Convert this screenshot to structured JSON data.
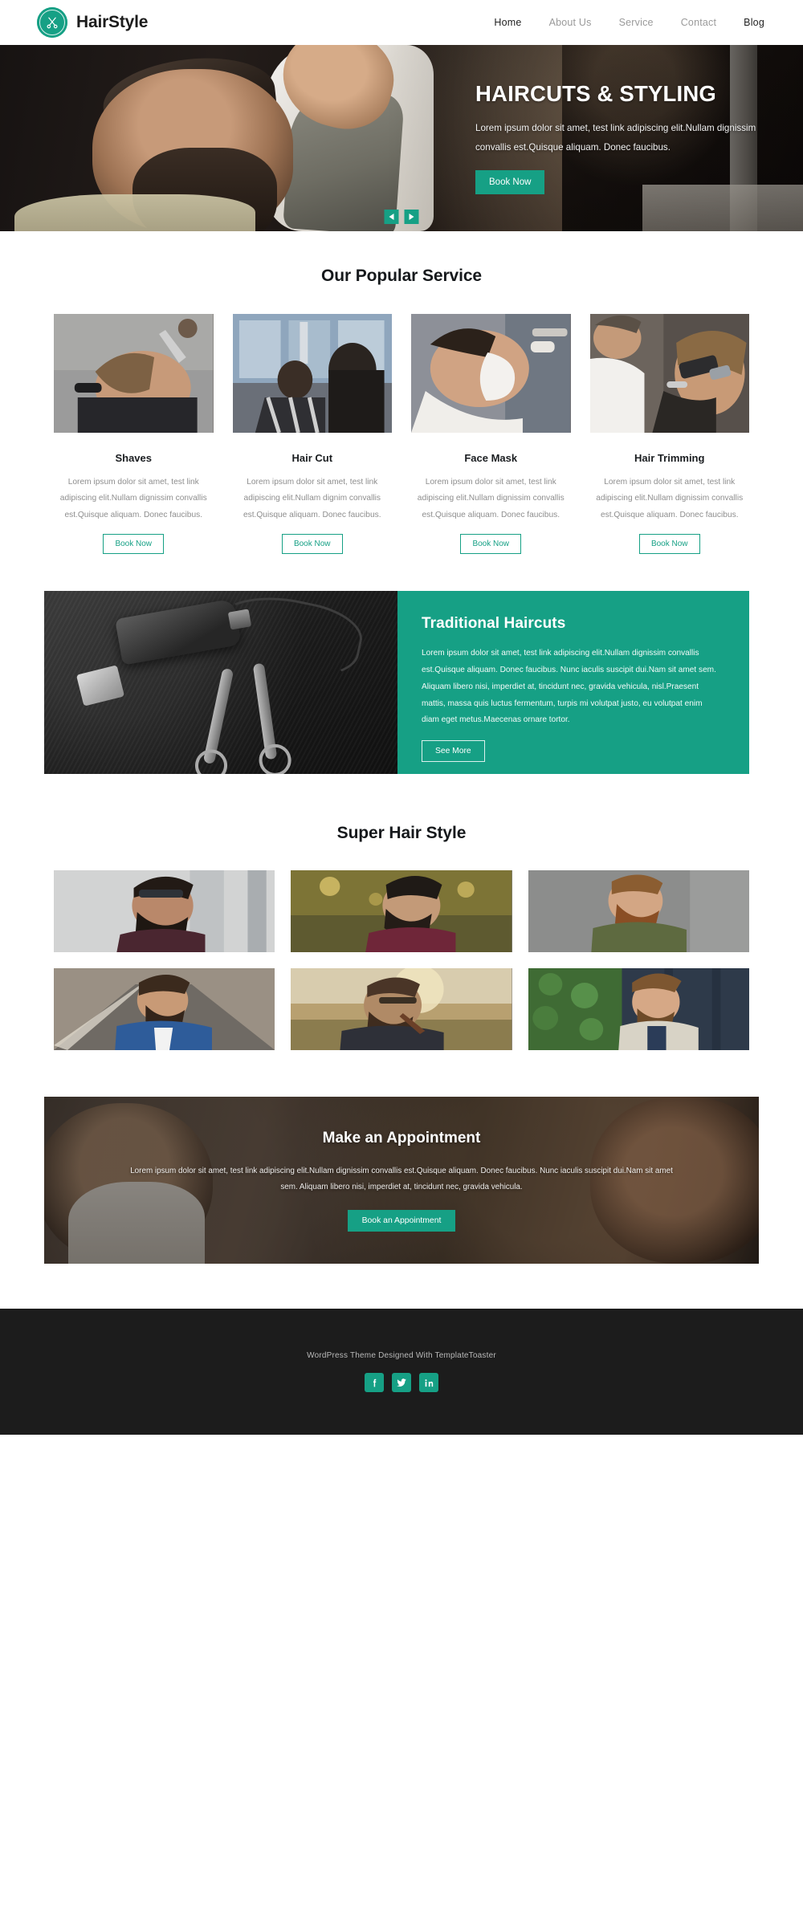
{
  "brand": {
    "name": "HairStyle",
    "logo_icon": "scissors-badge-icon"
  },
  "nav": {
    "items": [
      {
        "label": "Home",
        "active": true
      },
      {
        "label": "About Us",
        "active": false
      },
      {
        "label": "Service",
        "active": false
      },
      {
        "label": "Contact",
        "active": false
      },
      {
        "label": "Blog",
        "active": true
      }
    ]
  },
  "hero": {
    "title": "HAIRCUTS & STYLING",
    "subtitle": "Lorem ipsum dolor sit amet, test link adipiscing elit.Nullam dignissim convallis est.Quisque aliquam. Donec faucibus.",
    "cta": "Book Now",
    "prev_icon": "chevron-left-icon",
    "next_icon": "chevron-right-icon"
  },
  "services": {
    "title": "Our Popular Service",
    "cards": [
      {
        "name": "Shaves",
        "desc": "Lorem ipsum dolor sit amet, test link adipiscing elit.Nullam dignissim convallis est.Quisque aliquam. Donec faucibus.",
        "cta": "Book Now"
      },
      {
        "name": "Hair Cut",
        "desc": "Lorem ipsum dolor sit amet, test link adipiscing elit.Nullam dignim convallis est.Quisque aliquam. Donec faucibus.",
        "cta": "Book Now"
      },
      {
        "name": "Face Mask",
        "desc": "Lorem ipsum dolor sit amet, test link adipiscing elit.Nullam dignissim convallis est.Quisque aliquam. Donec faucibus.",
        "cta": "Book Now"
      },
      {
        "name": "Hair Trimming",
        "desc": "Lorem ipsum dolor sit amet, test link adipiscing elit.Nullam dignissim convallis est.Quisque aliquam. Donec faucibus.",
        "cta": "Book Now"
      }
    ]
  },
  "traditional": {
    "title": "Traditional Haircuts",
    "text": "Lorem ipsum dolor sit amet, test link adipiscing elit.Nullam dignissim convallis est.Quisque aliquam. Donec faucibus. Nunc iaculis suscipit dui.Nam sit amet sem. Aliquam libero nisi, imperdiet at, tincidunt nec, gravida vehicula, nisl.Praesent mattis, massa quis luctus fermentum, turpis mi volutpat justo, eu volutpat enim diam eget metus.Maecenas ornare tortor.",
    "cta": "See More"
  },
  "gallery": {
    "title": "Super Hair Style",
    "items": [
      {
        "alt": "man-with-sunglasses-beard"
      },
      {
        "alt": "man-in-maroon-shirt-sunset"
      },
      {
        "alt": "man-green-shirt-grey-wall"
      },
      {
        "alt": "man-in-blue-suit-on-road"
      },
      {
        "alt": "man-with-pipe-sunset"
      },
      {
        "alt": "man-with-vest-by-greenery"
      }
    ]
  },
  "appointment": {
    "title": "Make an Appointment",
    "text": "Lorem ipsum dolor sit amet, test link adipiscing elit.Nullam dignissim convallis est.Quisque aliquam. Donec faucibus. Nunc iaculis suscipit dui.Nam sit amet sem. Aliquam libero nisi, imperdiet at, tincidunt nec, gravida vehicula.",
    "cta": "Book an Appointment"
  },
  "footer": {
    "text": "WordPress Theme Designed With TemplateToaster",
    "socials": [
      {
        "name": "facebook-icon"
      },
      {
        "name": "twitter-icon"
      },
      {
        "name": "linkedin-icon"
      }
    ]
  },
  "colors": {
    "accent": "#16a085",
    "dark": "#1c1c1c",
    "muted": "#8e8e8e"
  }
}
